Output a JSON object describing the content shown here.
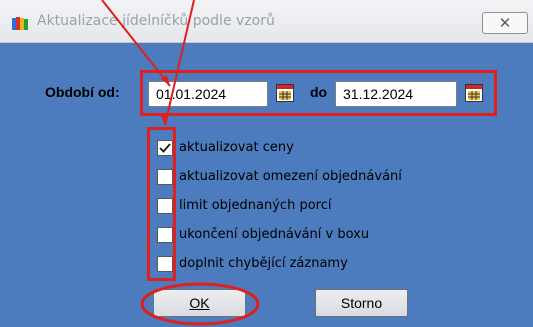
{
  "window": {
    "title": "Aktualizace jídelníčků podle vzorů",
    "close_label": "✕"
  },
  "period": {
    "from_label": "Období od",
    "from_value": "01.01.2024",
    "to_label": "do",
    "to_value": "31.12.2024"
  },
  "options": [
    {
      "label": "aktualizovat ceny",
      "checked": true
    },
    {
      "label": "aktualizovat omezení objednávání",
      "checked": false
    },
    {
      "label": "limit objednaných porcí",
      "checked": false
    },
    {
      "label": "ukončení objednávání v boxu",
      "checked": false
    },
    {
      "label": "doplnit chybějící záznamy",
      "checked": false
    }
  ],
  "buttons": {
    "ok_label": "OK",
    "cancel_label": "Storno"
  },
  "colors": {
    "dialog_background": "#4c7cbd",
    "annotation_red": "#e01f1f"
  }
}
